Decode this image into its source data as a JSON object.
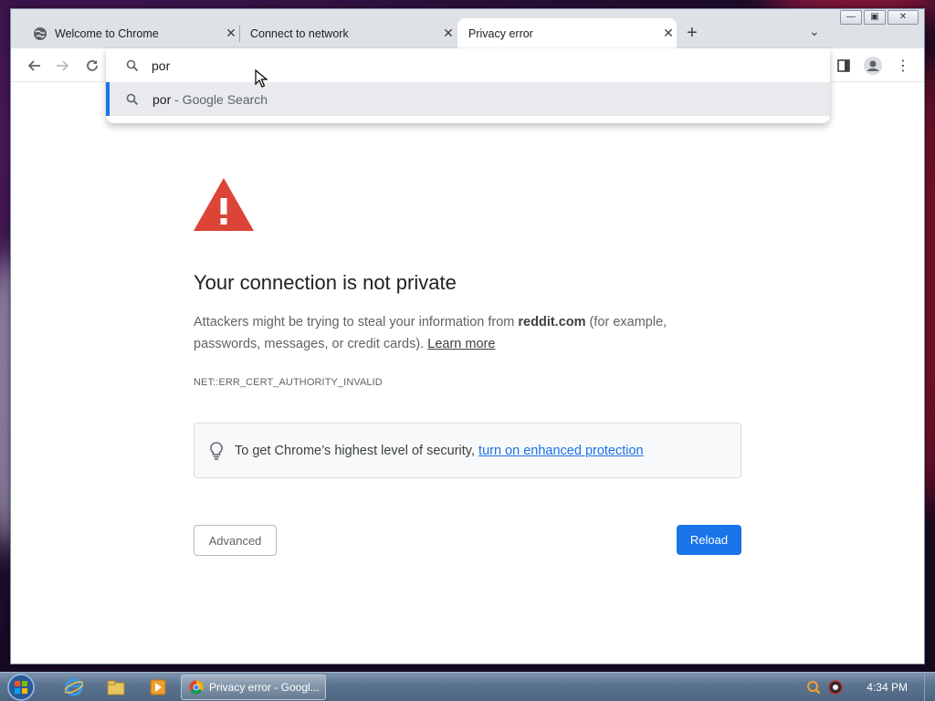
{
  "browser": {
    "tabs": [
      {
        "title": "Welcome to Chrome",
        "active": false
      },
      {
        "title": "Connect to network",
        "active": false
      },
      {
        "title": "Privacy error",
        "active": true
      }
    ],
    "omnibox": {
      "value": "por",
      "suggestion": {
        "query": "por",
        "suffix": " - Google Search"
      }
    }
  },
  "page": {
    "heading": "Your connection is not private",
    "desc_before": "Attackers might be trying to steal your information from ",
    "desc_domain": "reddit.com",
    "desc_after": " (for example, passwords, messages, or credit cards). ",
    "learn_more": "Learn more",
    "error_code": "NET::ERR_CERT_AUTHORITY_INVALID",
    "enhanced_text": "To get Chrome’s highest level of security, ",
    "enhanced_link": "turn on enhanced protection",
    "advanced_label": "Advanced",
    "reload_label": "Reload",
    "colors": {
      "accent": "#1a73e8",
      "warning": "#db4437"
    }
  },
  "taskbar": {
    "task_label": "Privacy error - Googl...",
    "clock": "4:34 PM"
  }
}
